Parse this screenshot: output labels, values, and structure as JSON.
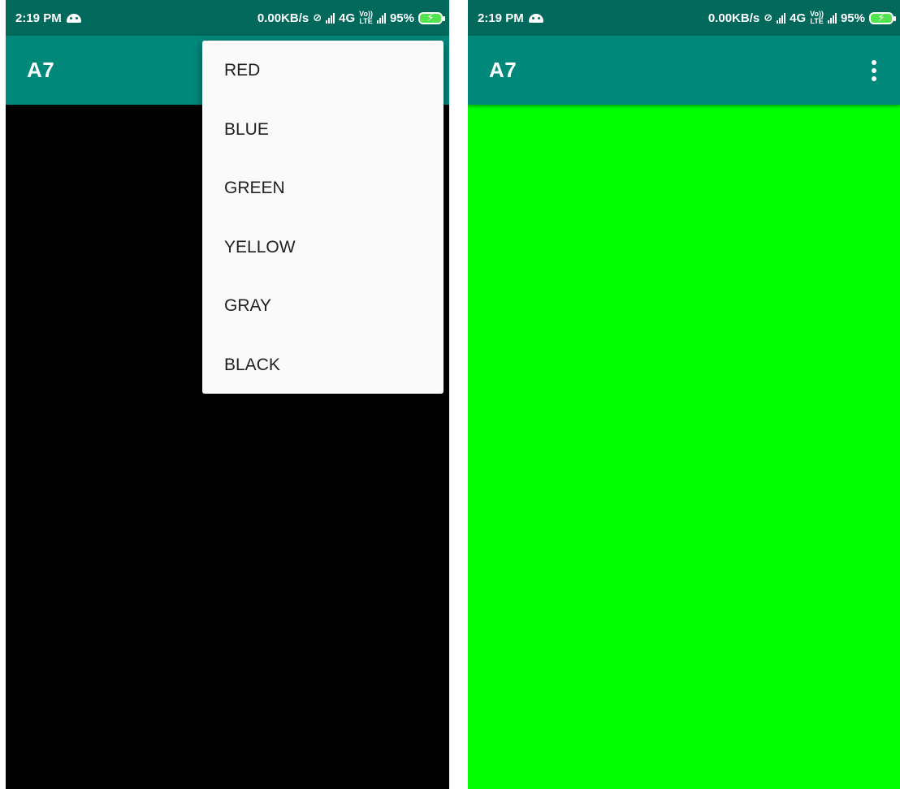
{
  "screens": [
    {
      "status_bar": {
        "time": "2:19 PM",
        "speed": "0.00KB/s",
        "network": "4G",
        "volte_top": "Vo))",
        "volte_bottom": "LTE",
        "battery": "95%"
      },
      "app_bar": {
        "title": "A7"
      },
      "background_color": "#000000",
      "menu": {
        "items": [
          "RED",
          "BLUE",
          "GREEN",
          "YELLOW",
          "GRAY",
          "BLACK"
        ]
      }
    },
    {
      "status_bar": {
        "time": "2:19 PM",
        "speed": "0.00KB/s",
        "network": "4G",
        "volte_top": "Vo))",
        "volte_bottom": "LTE",
        "battery": "95%"
      },
      "app_bar": {
        "title": "A7",
        "overflow_icon": "more-vert-icon"
      },
      "background_color": "#00ff00"
    }
  ],
  "colors": {
    "status_bar": "#00695c",
    "app_bar": "#00897b",
    "menu_background": "#fafafa",
    "menu_text": "#212121",
    "battery": "#52e34e"
  }
}
